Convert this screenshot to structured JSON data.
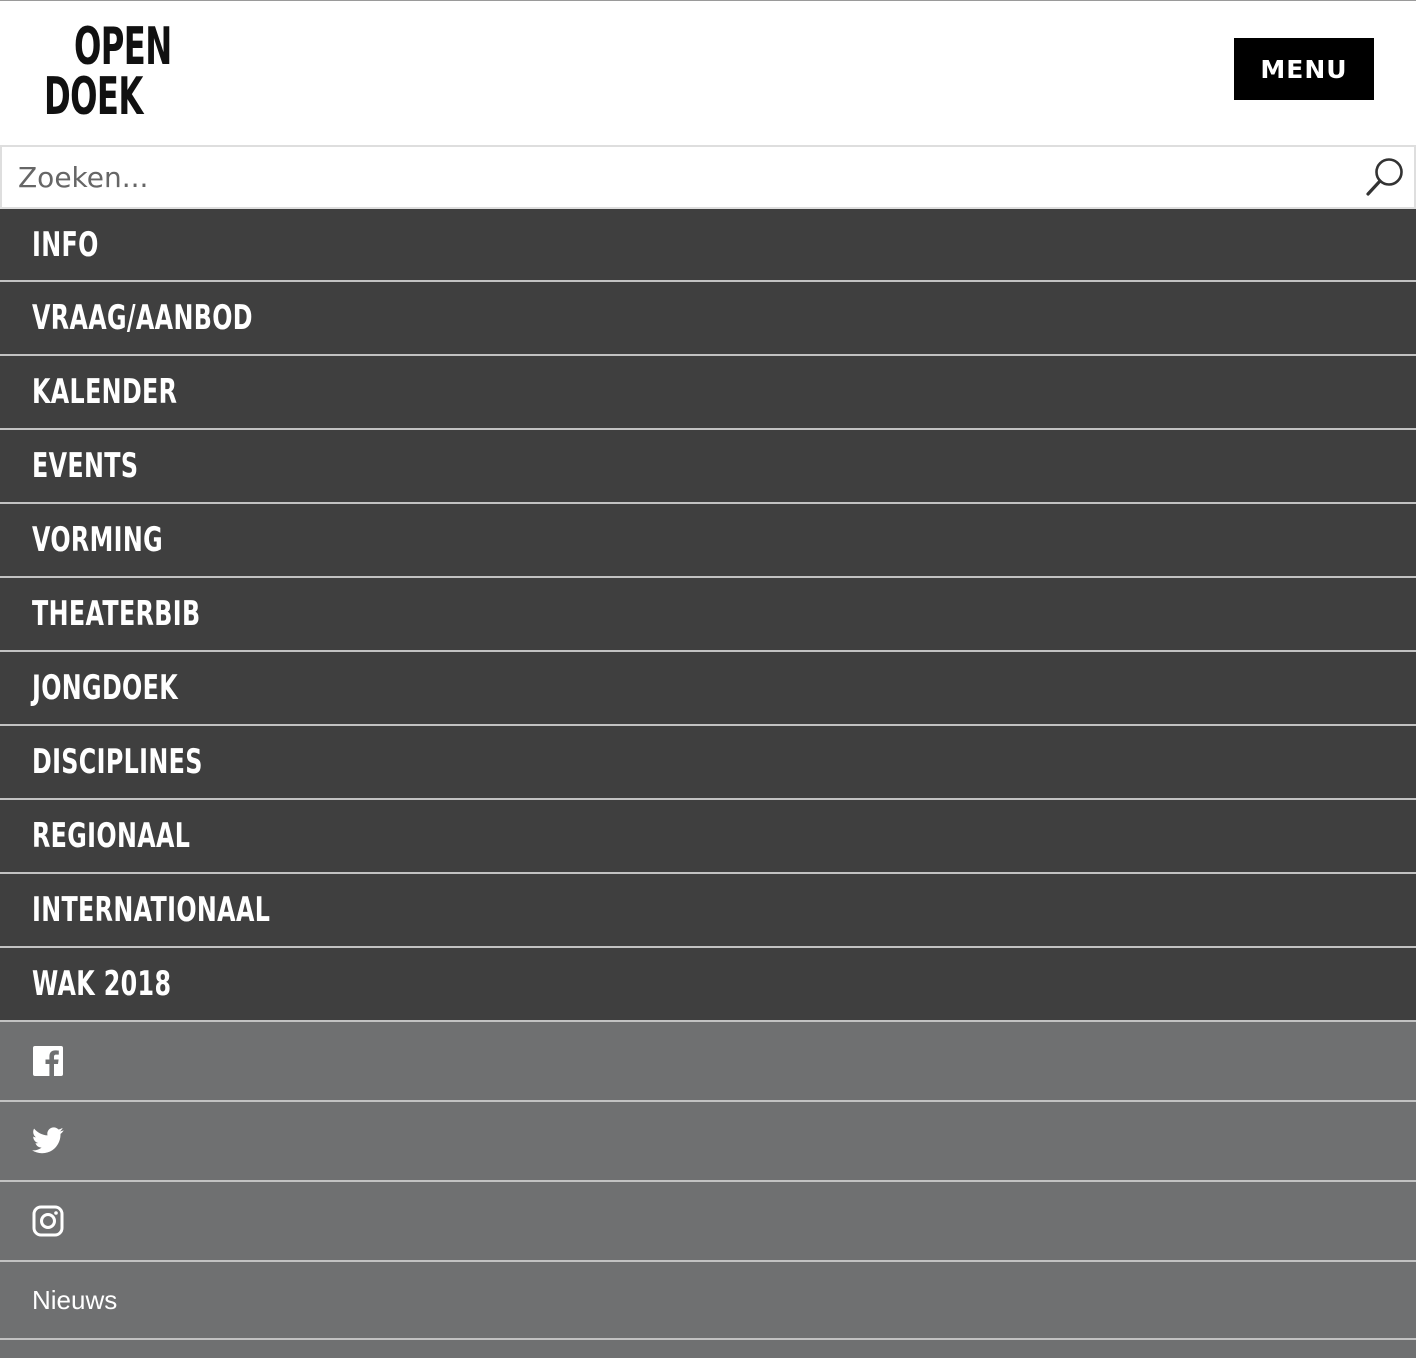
{
  "header": {
    "logo_line1": "OPEN",
    "logo_line2": "DOEK",
    "menu_label": "MENU"
  },
  "search": {
    "placeholder": "Zoeken...",
    "value": ""
  },
  "nav": {
    "items": [
      {
        "label": "INFO"
      },
      {
        "label": "VRAAG/AANBOD"
      },
      {
        "label": "KALENDER"
      },
      {
        "label": "EVENTS"
      },
      {
        "label": "VORMING"
      },
      {
        "label": "THEATERBIB"
      },
      {
        "label": "JONGDOEK"
      },
      {
        "label": "DISCIPLINES"
      },
      {
        "label": "REGIONAAL"
      },
      {
        "label": "INTERNATIONAAL"
      },
      {
        "label": "WAK 2018"
      }
    ]
  },
  "social": {
    "facebook_icon": "facebook-icon",
    "twitter_icon": "twitter-icon",
    "instagram_icon": "instagram-icon"
  },
  "secondary": {
    "news_label": "Nieuws"
  },
  "colors": {
    "nav_bg": "#3f3f3f",
    "secondary_bg": "#6f7071",
    "divider": "#c2c2c2",
    "menu_button_bg": "#000000"
  }
}
